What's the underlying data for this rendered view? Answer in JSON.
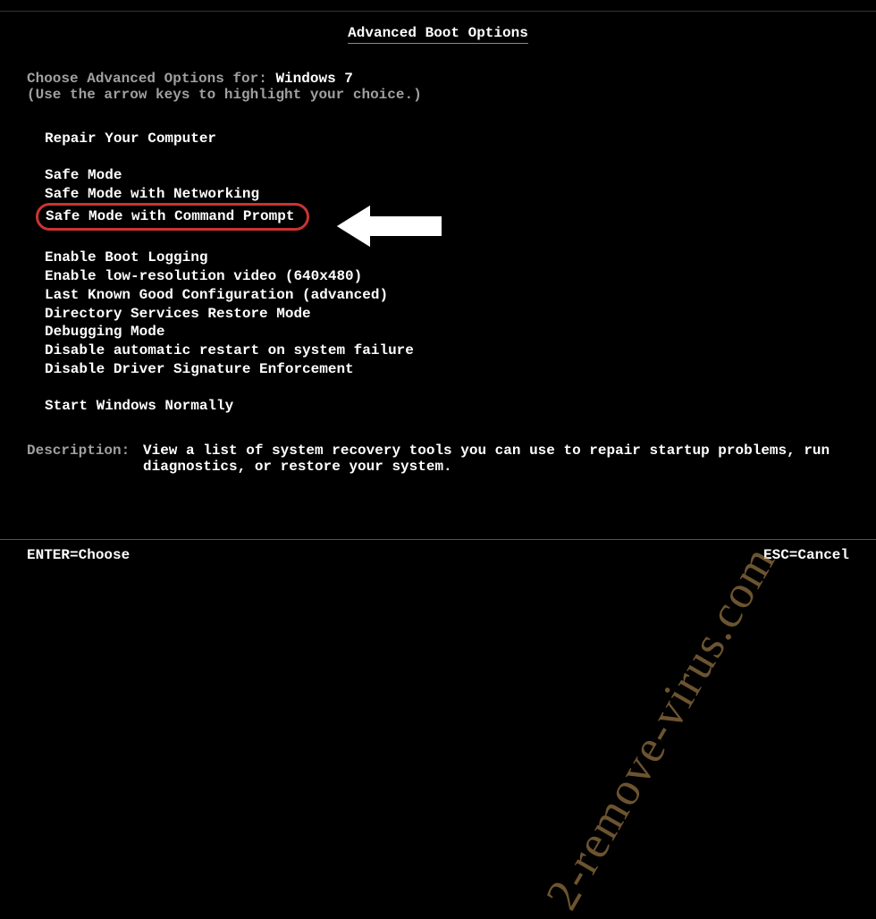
{
  "title": "Advanced Boot Options",
  "choose_prefix": "Choose Advanced Options for: ",
  "os_name": "Windows 7",
  "instruction": "(Use the arrow keys to highlight your choice.)",
  "menu": {
    "section1": [
      "Repair Your Computer"
    ],
    "section2": [
      "Safe Mode",
      "Safe Mode with Networking",
      "Safe Mode with Command Prompt"
    ],
    "section3": [
      "Enable Boot Logging",
      "Enable low-resolution video (640x480)",
      "Last Known Good Configuration (advanced)",
      "Directory Services Restore Mode",
      "Debugging Mode",
      "Disable automatic restart on system failure",
      "Disable Driver Signature Enforcement"
    ],
    "section4": [
      "Start Windows Normally"
    ]
  },
  "highlighted_index": 2,
  "description": {
    "label": "Description:",
    "text": "View a list of system recovery tools you can use to repair startup problems, run diagnostics, or restore your system."
  },
  "footer": {
    "enter": "ENTER=Choose",
    "esc": "ESC=Cancel"
  },
  "watermark": "2-remove-virus.com"
}
